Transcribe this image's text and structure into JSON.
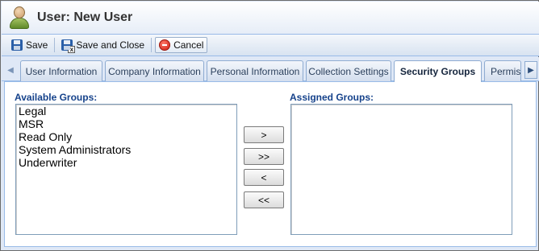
{
  "window": {
    "title": "User: New User"
  },
  "toolbar": {
    "save_label": "Save",
    "save_close_label": "Save and Close",
    "cancel_label": "Cancel"
  },
  "tabs": [
    {
      "label": "User Information"
    },
    {
      "label": "Company Information"
    },
    {
      "label": "Personal Information"
    },
    {
      "label": "Collection Settings"
    },
    {
      "label": "Security Groups",
      "active": true
    },
    {
      "label": "Permiss"
    }
  ],
  "available": {
    "label": "Available Groups:",
    "items": [
      "Legal",
      "MSR",
      "Read Only",
      "System Administrators",
      "Underwriter"
    ]
  },
  "assigned": {
    "label": "Assigned Groups:",
    "items": []
  },
  "transfer": {
    "add_one": ">",
    "add_all": ">>",
    "remove_one": "<",
    "remove_all": "<<"
  },
  "icons": {
    "user": "user-icon",
    "save": "floppy-disk-icon",
    "save_close": "floppy-close-icon",
    "cancel": "cancel-icon",
    "scroll_left": "arrow-left-icon",
    "scroll_right": "arrow-right-icon"
  },
  "colors": {
    "accent": "#15428b",
    "panel_border": "#99bbe8",
    "background": "#dfe8f6"
  }
}
